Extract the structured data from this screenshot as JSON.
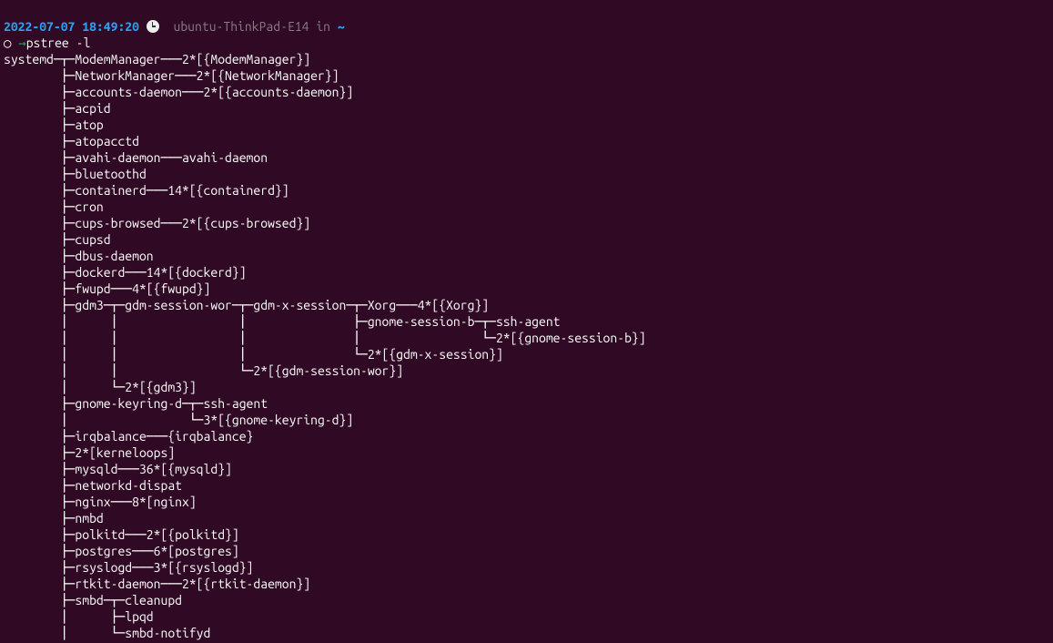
{
  "prompt": {
    "timestamp": "2022-07-07 18:49:20",
    "hostname": "ubuntu-ThinkPad-E14",
    "in_word": "in",
    "cwd": "~",
    "symbol_circle": "○",
    "symbol_arrow": "→",
    "command": "pstree -l"
  },
  "tree_lines": [
    "systemd─┬─ModemManager───2*[{ModemManager}]",
    "        ├─NetworkManager───2*[{NetworkManager}]",
    "        ├─accounts-daemon───2*[{accounts-daemon}]",
    "        ├─acpid",
    "        ├─atop",
    "        ├─atopacctd",
    "        ├─avahi-daemon───avahi-daemon",
    "        ├─bluetoothd",
    "        ├─containerd───14*[{containerd}]",
    "        ├─cron",
    "        ├─cups-browsed───2*[{cups-browsed}]",
    "        ├─cupsd",
    "        ├─dbus-daemon",
    "        ├─dockerd───14*[{dockerd}]",
    "        ├─fwupd───4*[{fwupd}]",
    "        ├─gdm3─┬─gdm-session-wor─┬─gdm-x-session─┬─Xorg───4*[{Xorg}]",
    "        │      │                 │               ├─gnome-session-b─┬─ssh-agent",
    "        │      │                 │               │                 └─2*[{gnome-session-b}]",
    "        │      │                 │               └─2*[{gdm-x-session}]",
    "        │      │                 └─2*[{gdm-session-wor}]",
    "        │      └─2*[{gdm3}]",
    "        ├─gnome-keyring-d─┬─ssh-agent",
    "        │                 └─3*[{gnome-keyring-d}]",
    "        ├─irqbalance───{irqbalance}",
    "        ├─2*[kerneloops]",
    "        ├─mysqld───36*[{mysqld}]",
    "        ├─networkd-dispat",
    "        ├─nginx───8*[nginx]",
    "        ├─nmbd",
    "        ├─polkitd───2*[{polkitd}]",
    "        ├─postgres───6*[postgres]",
    "        ├─rsyslogd───3*[{rsyslogd}]",
    "        ├─rtkit-daemon───2*[{rtkit-daemon}]",
    "        ├─smbd─┬─cleanupd",
    "        │      ├─lpqd",
    "        │      └─smbd-notifyd"
  ]
}
